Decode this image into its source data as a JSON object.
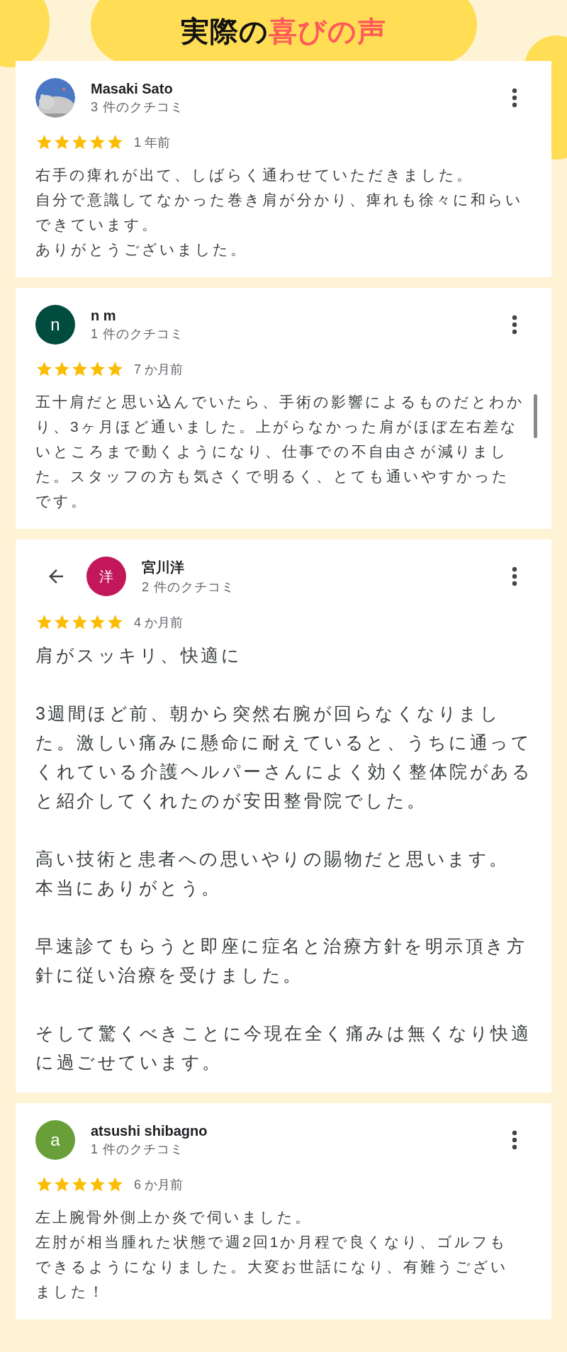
{
  "header": {
    "title": "実際の",
    "highlight": "喜びの声"
  },
  "reviews": [
    {
      "name": "Masaki Sato",
      "count": "3 件のクチコミ",
      "avatar": {
        "kind": "picture"
      },
      "back_button": false,
      "stars": 5,
      "time": "1 年前",
      "large": false,
      "scrollbar": false,
      "paragraphs": [
        [
          "右手の痺れが出て、しばらく通わせていただきました。",
          "自分で意識してなかった巻き肩が分かり、痺れも徐々に和らいできています。",
          "ありがとうございました。"
        ]
      ]
    },
    {
      "name": "n m",
      "count": "1 件のクチコミ",
      "avatar": {
        "kind": "letter",
        "letter": "n",
        "color": "#004d40"
      },
      "back_button": false,
      "stars": 5,
      "time": "7 か月前",
      "large": false,
      "scrollbar": true,
      "paragraphs": [
        [
          "五十肩だと思い込んでいたら、手術の影響によるものだとわかり、3ヶ月ほど通いました。上がらなかった肩がほぼ左右差ないところまで動くようになり、仕事での不自由さが減りました。スタッフの方も気さくで明るく、とても通いやすかったです。"
        ]
      ]
    },
    {
      "name": "宮川洋",
      "count": "2 件のクチコミ",
      "avatar": {
        "kind": "letter",
        "letter": "洋",
        "color": "#c2185b"
      },
      "back_button": true,
      "stars": 5,
      "time": "4 か月前",
      "large": true,
      "scrollbar": false,
      "paragraphs": [
        [
          "肩がスッキリ、快適に"
        ],
        [
          "3週間ほど前、朝から突然右腕が回らなくなりました。激しい痛みに懸命に耐えていると、うちに通ってくれている介護ヘルパーさんによく効く整体院があると紹介してくれたのが安田整骨院でした。"
        ],
        [
          "高い技術と患者への思いやりの賜物だと思います。",
          "本当にありがとう。"
        ],
        [
          "早速診てもらうと即座に症名と治療方針を明示頂き方針に従い治療を受けました。"
        ],
        [
          "そして驚くべきことに今現在全く痛みは無くなり快適に過ごせています。"
        ]
      ]
    },
    {
      "name": "atsushi shibagno",
      "count": "1 件のクチコミ",
      "avatar": {
        "kind": "letter",
        "letter": "a",
        "color": "#689f38"
      },
      "back_button": false,
      "stars": 5,
      "time": "6 か月前",
      "large": false,
      "scrollbar": false,
      "paragraphs": [
        [
          "左上腕骨外側上か炎で伺いました。",
          "左肘が相当腫れた状態で週2回1か月程で良くなり、ゴルフもできるようになりました。大変お世話になり、有難うございました！"
        ]
      ]
    }
  ]
}
